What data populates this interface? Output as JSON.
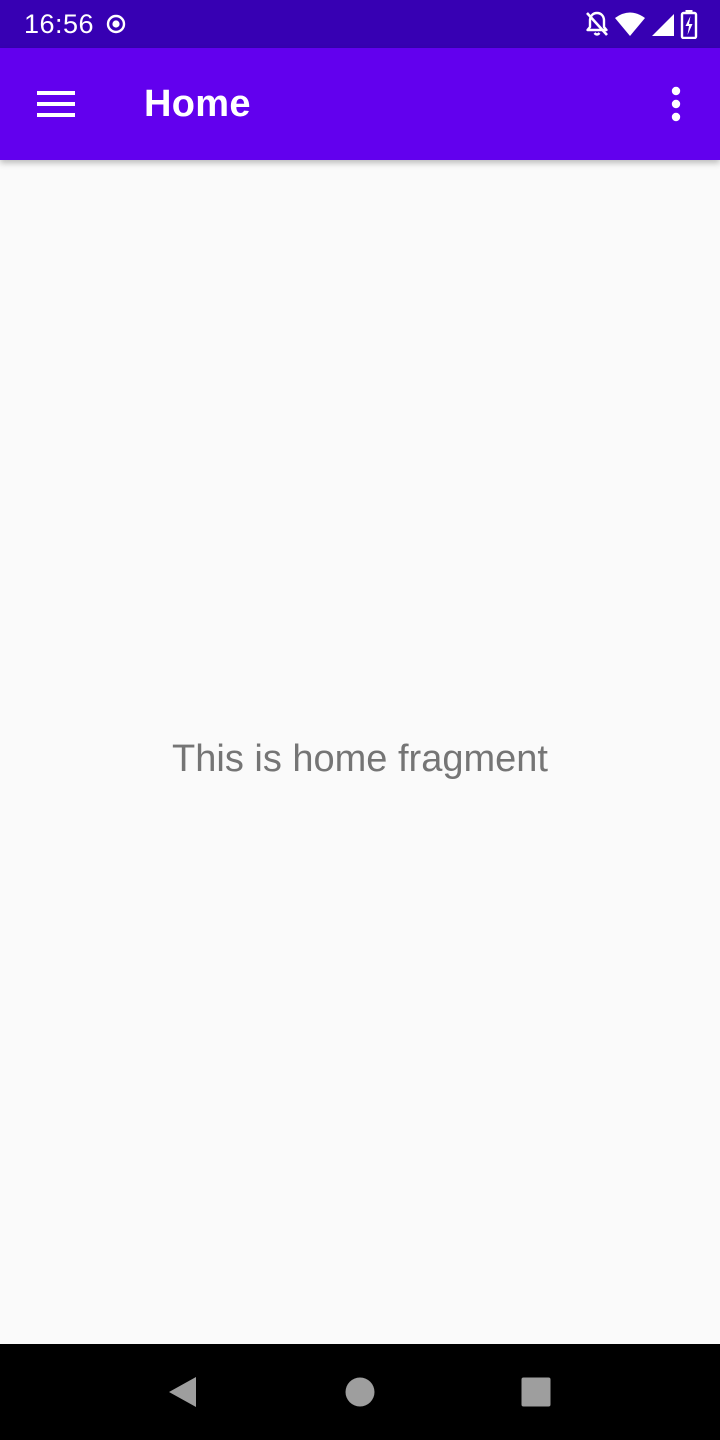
{
  "status_bar": {
    "time": "16:56",
    "icons": [
      "record-icon",
      "notifications-off-icon",
      "wifi-icon",
      "signal-icon",
      "battery-charging-icon"
    ]
  },
  "app_bar": {
    "title": "Home",
    "nav_icon": "menu-icon",
    "overflow_icon": "more-vert-icon"
  },
  "content": {
    "message": "This is home fragment"
  },
  "nav_bar": {
    "icons": [
      "back-icon",
      "home-icon",
      "recents-icon"
    ]
  },
  "colors": {
    "status_bar": "#3700b3",
    "primary": "#6200ee",
    "background": "#fafafa",
    "text_secondary": "#757575",
    "nav_bar": "#000000"
  }
}
